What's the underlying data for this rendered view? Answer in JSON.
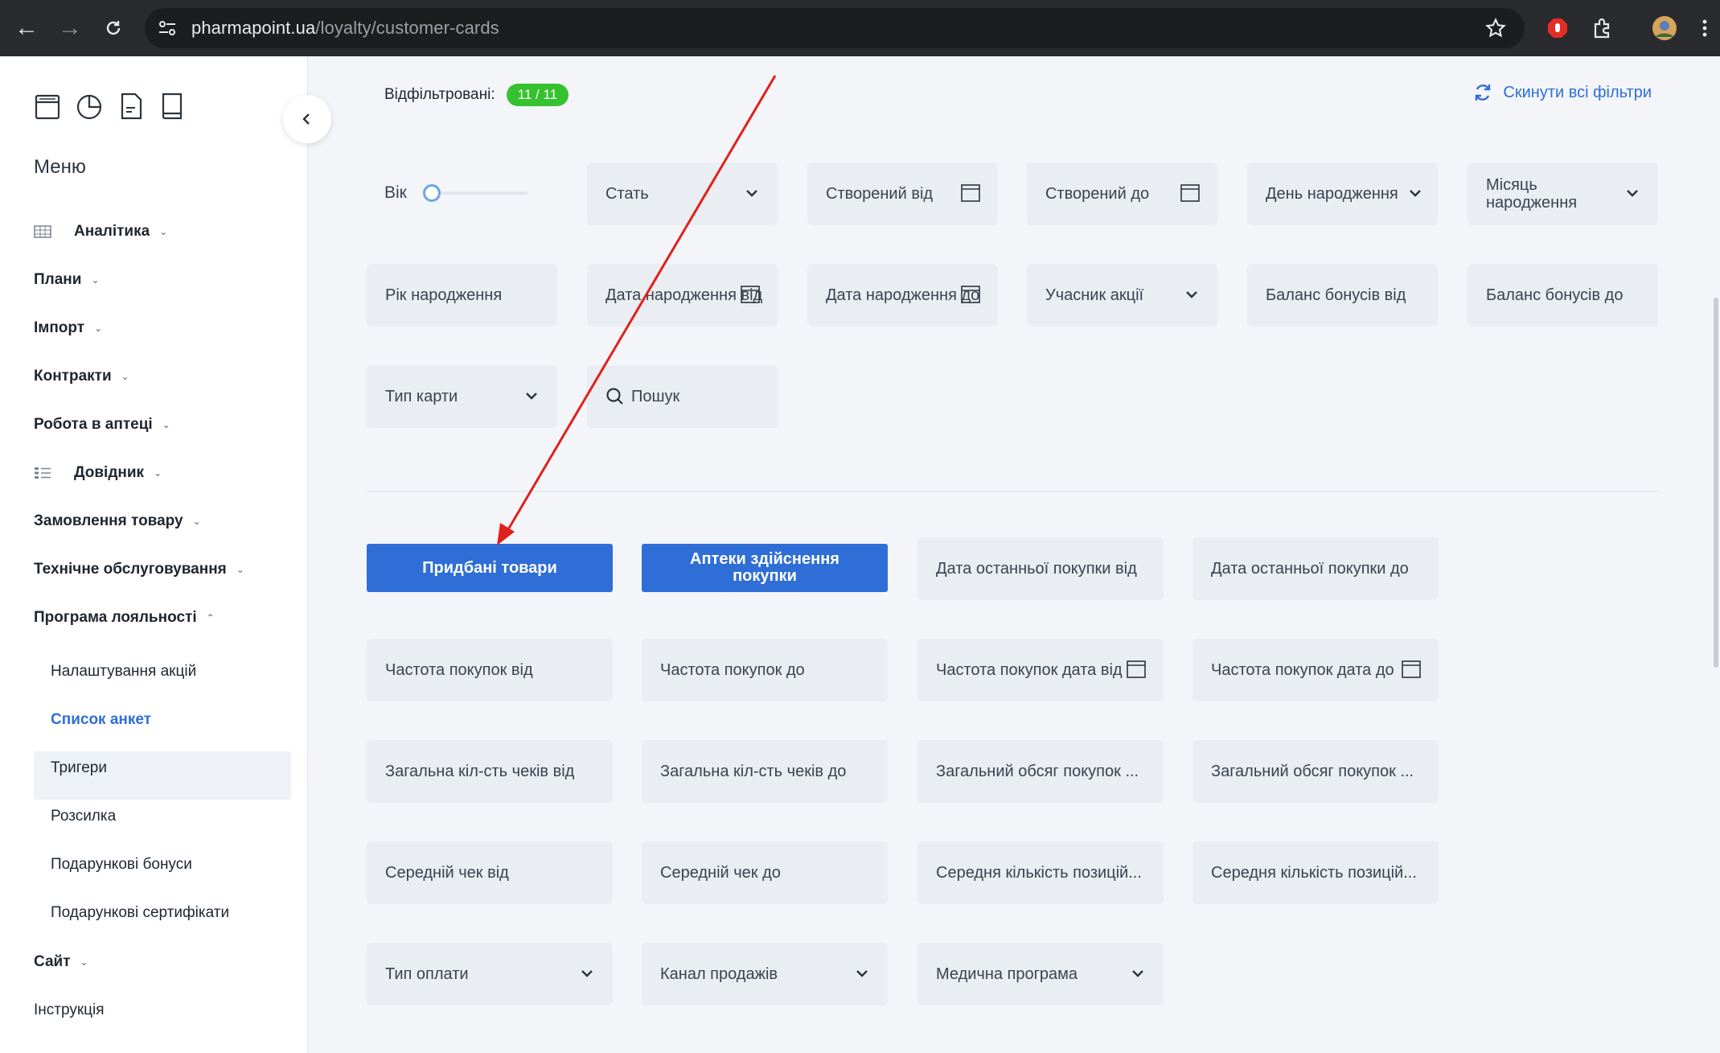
{
  "browser": {
    "url_host": "pharmapoint.ua",
    "url_path": "/loyalty/customer-cards"
  },
  "sidebar": {
    "menu_title": "Меню",
    "items": [
      {
        "label": "Аналітика"
      },
      {
        "label": "Плани"
      },
      {
        "label": "Імпорт"
      },
      {
        "label": "Контракти"
      },
      {
        "label": "Робота в аптеці"
      },
      {
        "label": "Довідник"
      },
      {
        "label": "Замовлення товару"
      },
      {
        "label": "Технічне обслуговування"
      },
      {
        "label": "Програма лояльності"
      },
      {
        "label": "Сайт"
      },
      {
        "label": "Інструкція"
      }
    ],
    "sub_items": [
      {
        "label": "Налаштування акцій"
      },
      {
        "label": "Список анкет"
      },
      {
        "label": "Тригери"
      },
      {
        "label": "Розсилка"
      },
      {
        "label": "Подарункові бонуси"
      },
      {
        "label": "Подарункові сертифікати"
      }
    ]
  },
  "header": {
    "filtered_label": "Відфільтровані:",
    "filtered_count": "11 / 11",
    "reset_label": "Скинути всі фільтри"
  },
  "filters": {
    "age_label": "Вік",
    "row1": [
      "Стать",
      "Створений від",
      "Створений до",
      "День народження",
      "Місяць народження"
    ],
    "row2": [
      "Рік народження",
      "Дата народження від",
      "Дата народження до",
      "Учасник акції",
      "Баланс бонусів від",
      "Баланс бонусів до"
    ],
    "row3": [
      "Тип карти",
      "Пошук"
    ]
  },
  "purchase": {
    "btn_bought": "Придбані товари",
    "btn_pharmacies": "Аптеки здійснення покупки",
    "last_from": "Дата останньої покупки від",
    "last_to": "Дата останньої покупки до",
    "freq_from": "Частота покупок від",
    "freq_to": "Частота покупок до",
    "freq_date_from": "Частота покупок дата від",
    "freq_date_to": "Частота покупок дата до",
    "checks_from": "Загальна кіл-сть чеків від",
    "checks_to": "Загальна кіл-сть чеків до",
    "volume_from": "Загальний обсяг покупок ...",
    "volume_to": "Загальний обсяг покупок ...",
    "avg_from": "Середній чек від",
    "avg_to": "Середній чек до",
    "avg_pos_from": "Середня кількість позицій...",
    "avg_pos_to": "Середня кількість позицій...",
    "payment_type": "Тип оплати",
    "sales_channel": "Канал продажів",
    "medical_program": "Медична програма"
  },
  "colors": {
    "accent": "#2f6ed6",
    "badge": "#36c22f",
    "annotation_arrow": "#e0201c"
  }
}
